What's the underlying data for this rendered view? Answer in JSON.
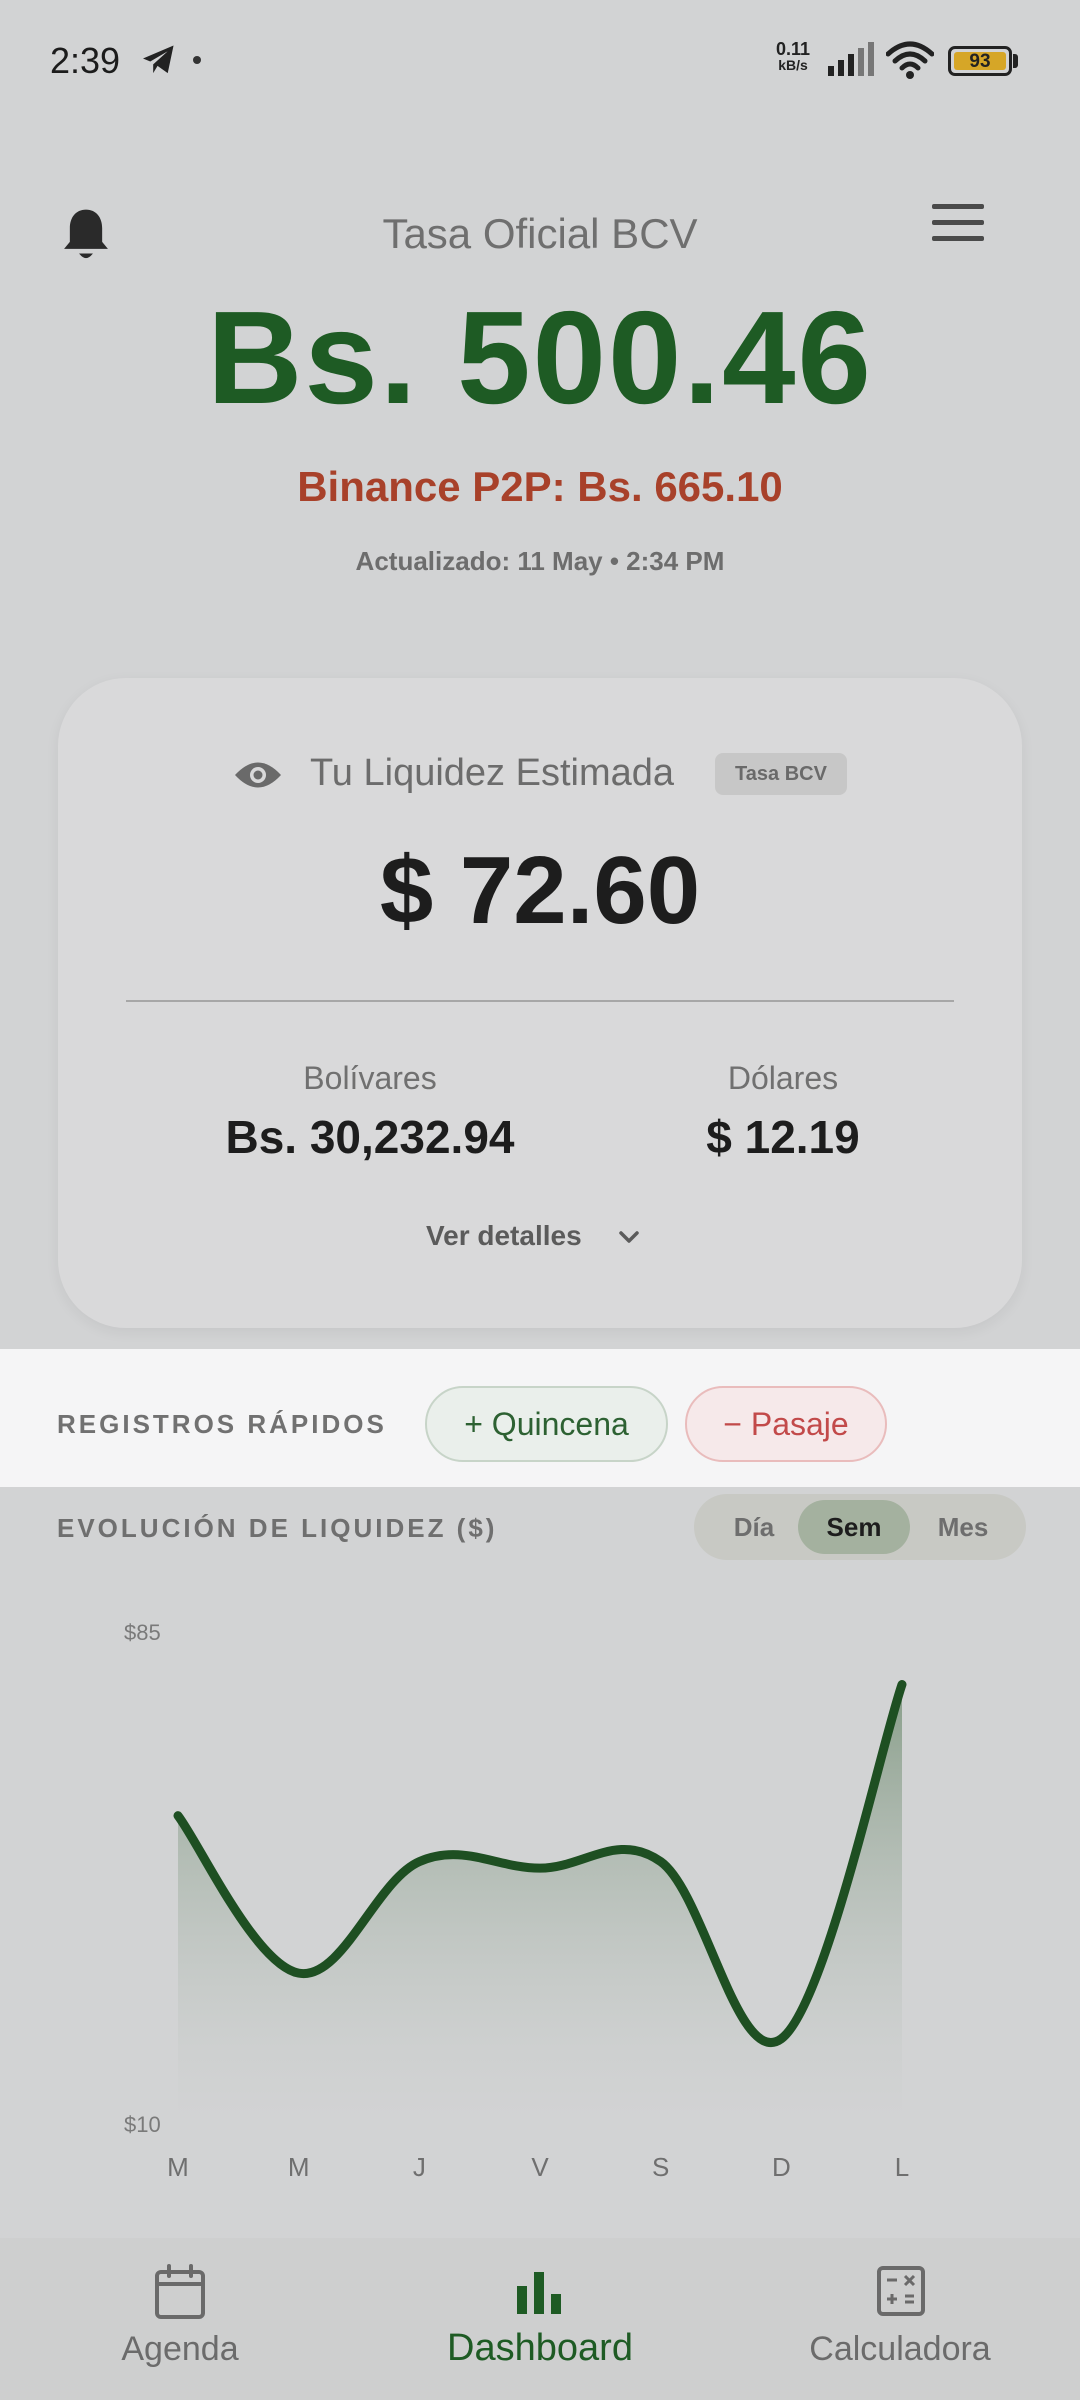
{
  "status_bar": {
    "time": "2:39",
    "net_speed_value": "0.11",
    "net_speed_unit": "kB/s",
    "battery": "93"
  },
  "header": {
    "title": "Tasa Oficial BCV",
    "rate": "Bs. 500.46",
    "binance": "Binance P2P: Bs. 665.10",
    "updated": "Actualizado: 11 May • 2:34 PM"
  },
  "liquidity_card": {
    "title": "Tu Liquidez Estimada",
    "badge": "Tasa BCV",
    "total": "$ 72.60",
    "bolivares_label": "Bolívares",
    "bolivares_value": "Bs. 30,232.94",
    "dolares_label": "Dólares",
    "dolares_value": "$ 12.19",
    "details_link": "Ver detalles"
  },
  "quick_records": {
    "label": "REGISTROS RÁPIDOS",
    "quincena": "+ Quincena",
    "pasaje": "− Pasaje"
  },
  "evolution": {
    "label": "EVOLUCIÓN DE LIQUIDEZ ($)",
    "segments": [
      "Día",
      "Sem",
      "Mes"
    ],
    "selected_segment": "Sem"
  },
  "chart_data": {
    "type": "area",
    "categories": [
      "M",
      "M",
      "J",
      "V",
      "S",
      "D",
      "L"
    ],
    "values": [
      57,
      33,
      50,
      49,
      50,
      23,
      77
    ],
    "ylim": [
      10,
      85
    ],
    "ytick_labels": [
      "$85",
      "$10"
    ],
    "line_color": "#1e4f22",
    "grid": false
  },
  "bottom_nav": {
    "agenda": "Agenda",
    "dashboard": "Dashboard",
    "calculadora": "Calculadora",
    "active": "Dashboard",
    "active_color": "#1e5b24"
  }
}
